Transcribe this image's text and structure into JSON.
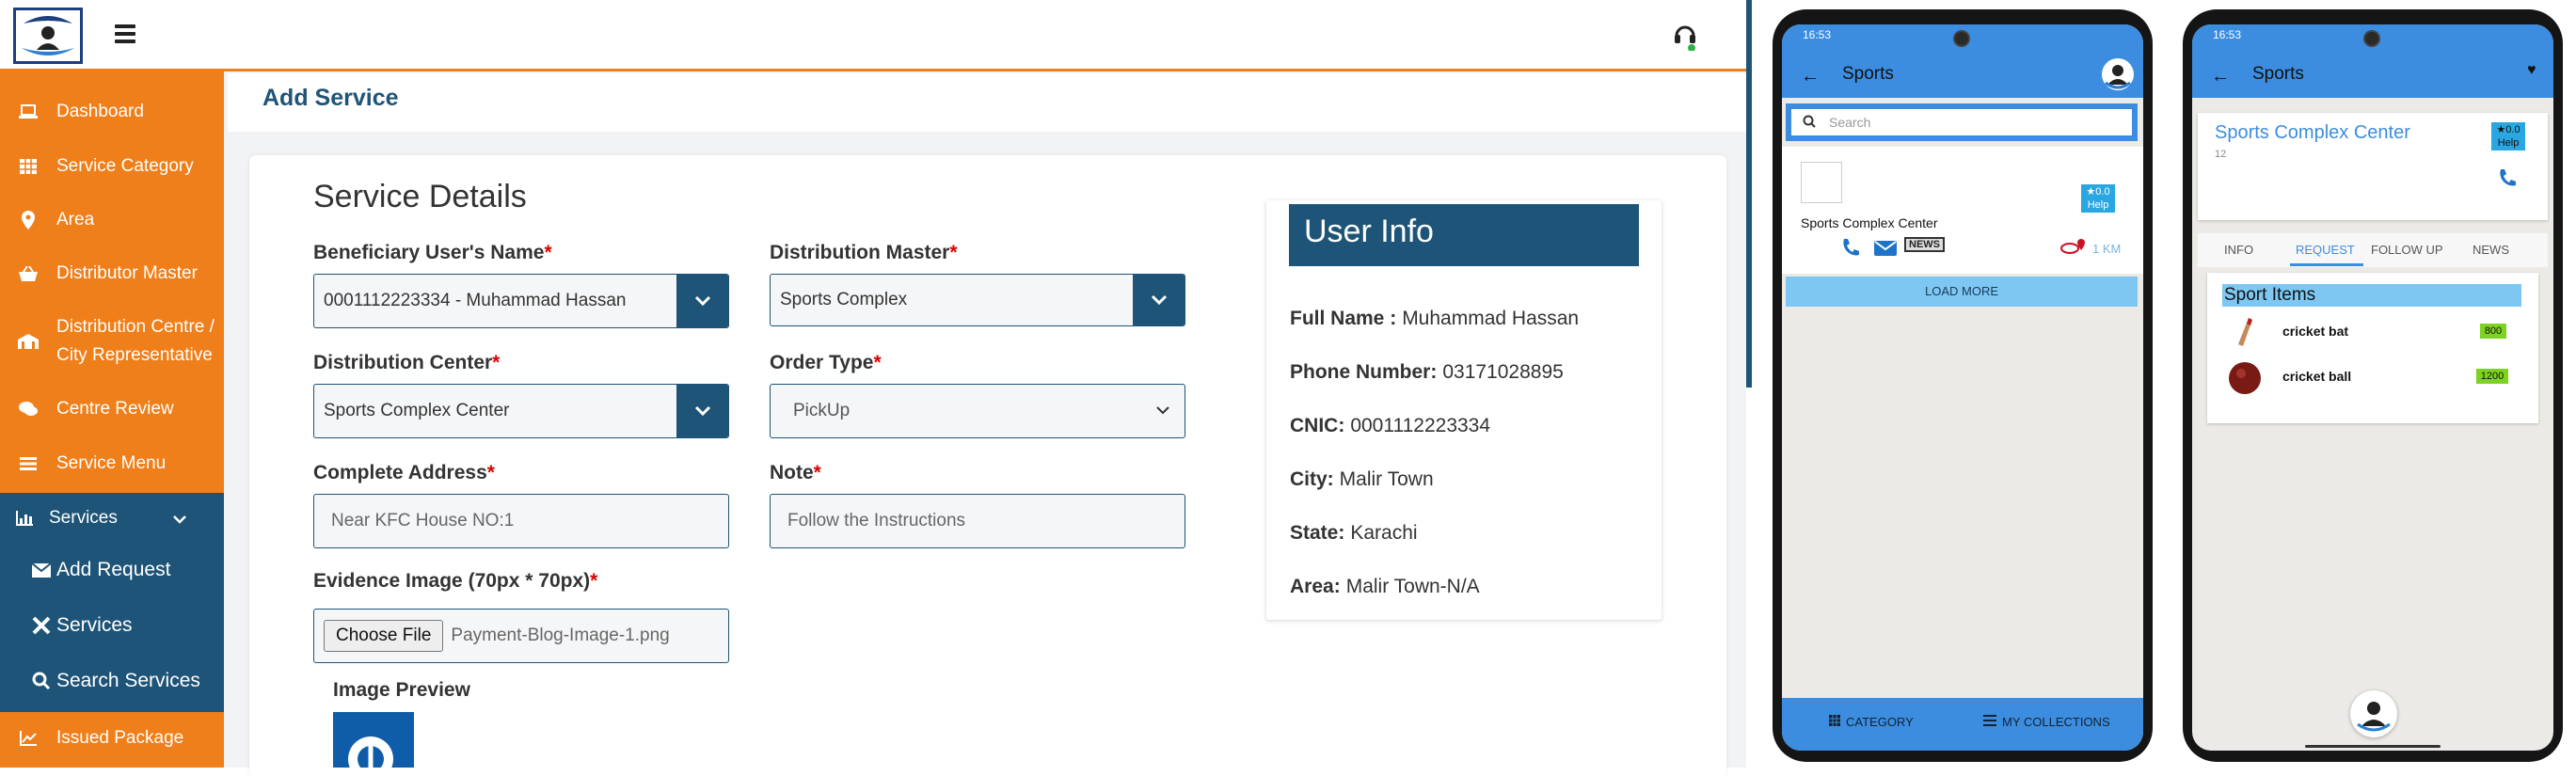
{
  "app": {
    "page_title": "Add Service",
    "section_title": "Service Details"
  },
  "sidebar": {
    "items": [
      {
        "label": "Dashboard",
        "icon": "laptop-icon"
      },
      {
        "label": "Service Category",
        "icon": "grid-icon"
      },
      {
        "label": "Area",
        "icon": "map-pin-icon"
      },
      {
        "label": "Distributor Master",
        "icon": "basket-icon"
      },
      {
        "label": "Distribution Centre /",
        "label2": "City Representative",
        "icon": "building-icon"
      },
      {
        "label": "Centre Review",
        "icon": "chat-icon"
      },
      {
        "label": "Service Menu",
        "icon": "menu-icon"
      }
    ],
    "services": {
      "label": "Services",
      "icon": "bar-chart-icon",
      "sub_items": [
        {
          "label": "Add Request",
          "icon": "envelope-icon"
        },
        {
          "label": "Services",
          "icon": "tools-icon"
        },
        {
          "label": "Search Services",
          "icon": "search-icon"
        }
      ]
    },
    "issued": {
      "label": "Issued Package",
      "icon": "line-chart-icon"
    }
  },
  "form": {
    "beneficiary": {
      "label": "Beneficiary User's Name",
      "value": "0001112223334 - Muhammad Hassan"
    },
    "distribution_master": {
      "label": "Distribution Master",
      "value": "Sports Complex"
    },
    "distribution_center": {
      "label": "Distribution Center",
      "value": "Sports Complex Center"
    },
    "order_type": {
      "label": "Order Type",
      "value": "PickUp"
    },
    "address": {
      "label": "Complete Address",
      "placeholder": "Near KFC House NO:1"
    },
    "note": {
      "label": "Note",
      "placeholder": "Follow the Instructions"
    },
    "evidence": {
      "label": "Evidence Image (70px * 70px)",
      "button": "Choose File",
      "filename": "Payment-Blog-Image-1.png"
    },
    "preview_label": "Image Preview",
    "required_mark": "*"
  },
  "user_info": {
    "title": "User Info",
    "rows": [
      {
        "label": "Full Name :",
        "value": "Muhammad Hassan"
      },
      {
        "label": "Phone Number:",
        "value": "03171028895"
      },
      {
        "label": "CNIC:",
        "value": "0001112223334"
      },
      {
        "label": "City:",
        "value": "Malir Town"
      },
      {
        "label": "State:",
        "value": "Karachi"
      },
      {
        "label": "Area:",
        "value": "Malir Town-N/A"
      }
    ]
  },
  "phone1": {
    "time": "16:53",
    "title": "Sports",
    "search_placeholder": "Search",
    "listing_name": "Sports Complex Center",
    "rating_line1": "★0.0",
    "rating_line2": "Help",
    "distance": "1 KM",
    "news_label": "NEWS",
    "load_more": "LOAD MORE",
    "bottom_left": "CATEGORY",
    "bottom_right": "MY COLLECTIONS"
  },
  "phone2": {
    "time": "16:53",
    "title": "Sports",
    "center_name": "Sports Complex Center",
    "center_sub": "12",
    "rating_line1": "★0.0",
    "rating_line2": "Help",
    "tabs": [
      "INFO",
      "REQUEST",
      "FOLLOW UP",
      "NEWS"
    ],
    "active_tab": "REQUEST",
    "items_title": "Sport Items",
    "items": [
      {
        "name": "cricket bat",
        "price": "800"
      },
      {
        "name": "cricket ball",
        "price": "1200"
      }
    ]
  },
  "colors": {
    "orange": "#ef7f1a",
    "navy": "#1e5478",
    "phone_blue": "#3c8ddf",
    "price_green": "#7ed321"
  }
}
